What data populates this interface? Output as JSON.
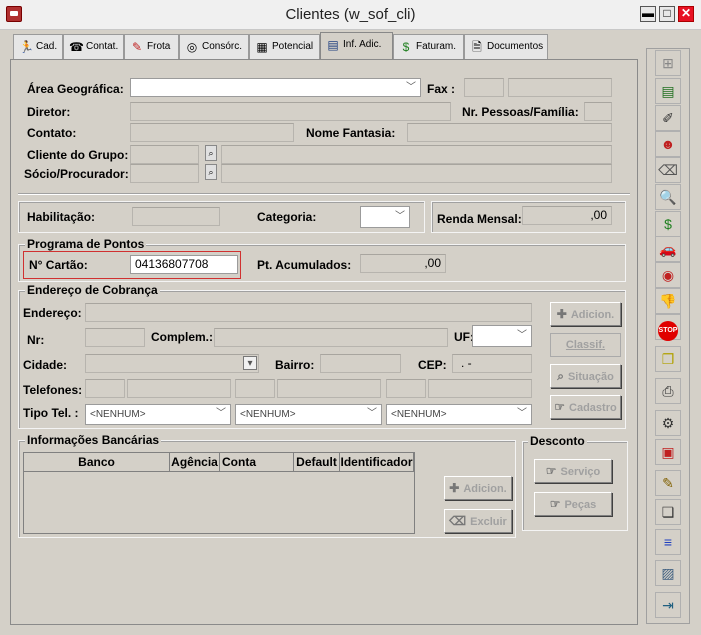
{
  "window": {
    "title": "Clientes (w_sof_cli)",
    "minimize": "▬",
    "maximize": "□",
    "close": "✕"
  },
  "tabs": [
    {
      "label": "Cad.",
      "icon": "runner-icon"
    },
    {
      "label": "Contat.",
      "icon": "phone-icon"
    },
    {
      "label": "Frota",
      "icon": "wrench-icon"
    },
    {
      "label": "Consórc.",
      "icon": "group-icon"
    },
    {
      "label": "Potencial",
      "icon": "grid-icon"
    },
    {
      "label": "Inf. Adic.",
      "icon": "table-icon"
    },
    {
      "label": "Faturam.",
      "icon": "money-bag-icon"
    },
    {
      "label": "Documentos",
      "icon": "document-icon"
    }
  ],
  "active_tab": "Inf. Adic.",
  "form": {
    "area_geografica": "Área Geográfica:",
    "fax": "Fax :",
    "diretor": "Diretor:",
    "nr_pessoas": "Nr. Pessoas/Família:",
    "contato": "Contato:",
    "nome_fantasia": "Nome Fantasia:",
    "cliente_grupo": "Cliente do Grupo:",
    "socio": "Sócio/Procurador:",
    "habilitacao": "Habilitação:",
    "categoria": "Categoria:",
    "renda_mensal": "Renda Mensal:",
    "renda_value": ",00"
  },
  "pontos": {
    "title": "Programa de Pontos",
    "cartao_label": "N° Cartão:",
    "cartao_value": "04136807708",
    "acumulados_label": "Pt. Acumulados:",
    "acumulados_value": ",00"
  },
  "cobranca": {
    "title": "Endereço de Cobrança",
    "endereco": "Endereço:",
    "nr": "Nr:",
    "complem": "Complem.:",
    "uf": "UF:",
    "cidade": "Cidade:",
    "bairro": "Bairro:",
    "cep": "CEP:",
    "cep_value": ".   -",
    "telefones": "Telefones:",
    "tipo_tel": "Tipo Tel. :",
    "tipo_options": [
      "<NENHUM>",
      "<NENHUM>",
      "<NENHUM>"
    ],
    "btn_adicion": "Adicion.",
    "btn_classif": "Classif.",
    "btn_situacao": "Situação",
    "btn_cadastro": "Cadastro"
  },
  "bancarias": {
    "title": "Informações Bancárias",
    "columns": [
      "Banco",
      "Agência",
      "Conta",
      "Default",
      "Identificador"
    ],
    "btn_adicion": "Adicion.",
    "btn_excluir": "Excluir"
  },
  "desconto": {
    "title": "Desconto",
    "btn_servico": "Serviço",
    "btn_pecas": "Peças"
  },
  "sidebar": [
    "tree-icon",
    "list-edit-icon",
    "brush-icon",
    "user-icon",
    "eraser-icon",
    "print-preview-icon",
    "money-bag-icon",
    "car-icon",
    "copy-document-icon",
    "thumbs-down-icon",
    "stop-icon",
    "windows-icon",
    "printer-icon",
    "gear-network-icon",
    "notes-icon",
    "edit-document-icon",
    "copy-icon",
    "align-icon",
    "image-edit-icon",
    "exit-icon"
  ],
  "colors": {
    "highlight_border": "#d03030",
    "stop": "#e00000"
  }
}
